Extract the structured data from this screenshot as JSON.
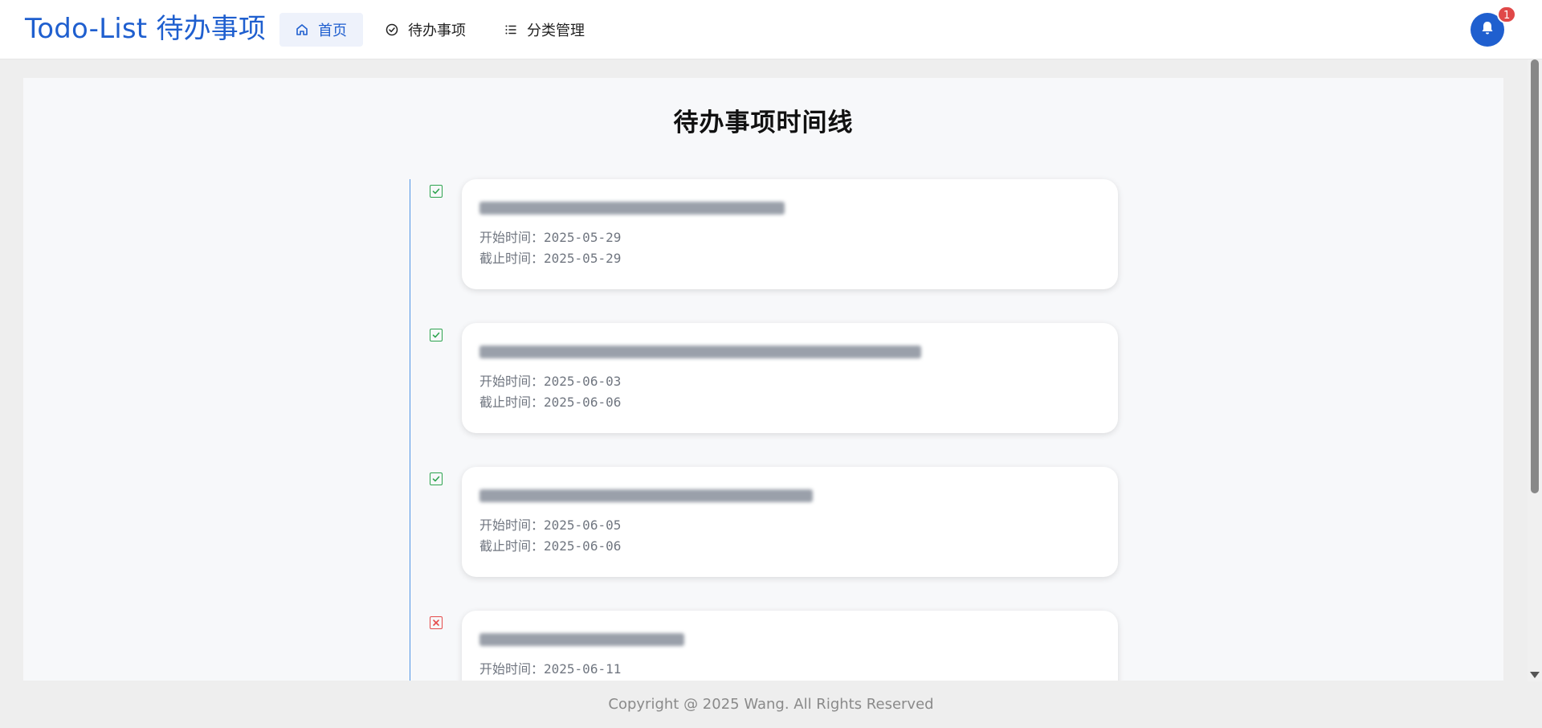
{
  "header": {
    "brand": "Todo-List 待办事项",
    "nav": [
      {
        "label": "首页",
        "icon": "home-icon",
        "active": true
      },
      {
        "label": "待办事项",
        "icon": "check-circle-icon",
        "active": false
      },
      {
        "label": "分类管理",
        "icon": "list-icon",
        "active": false
      }
    ],
    "notifications": {
      "icon": "bell-icon",
      "count": "1"
    }
  },
  "main": {
    "title": "待办事项时间线",
    "start_label": "开始时间：",
    "end_label": "截止时间：",
    "items": [
      {
        "title": "",
        "start": "2025-05-29",
        "end": "2025-05-29",
        "status": "done",
        "status_color": "#2ea44f"
      },
      {
        "title": "",
        "start": "2025-06-03",
        "end": "2025-06-06",
        "status": "done",
        "status_color": "#2ea44f"
      },
      {
        "title": "",
        "start": "2025-06-05",
        "end": "2025-06-06",
        "status": "done",
        "status_color": "#2ea44f"
      },
      {
        "title": "",
        "start": "2025-06-11",
        "end": "",
        "status": "failed",
        "status_color": "#e54b4b"
      }
    ]
  },
  "footer": {
    "copyright": "Copyright @ 2025 Wang. All Rights Reserved"
  },
  "colors": {
    "accent": "#1f5fcf",
    "timeline": "#4f94e6",
    "badge": "#e04848"
  }
}
